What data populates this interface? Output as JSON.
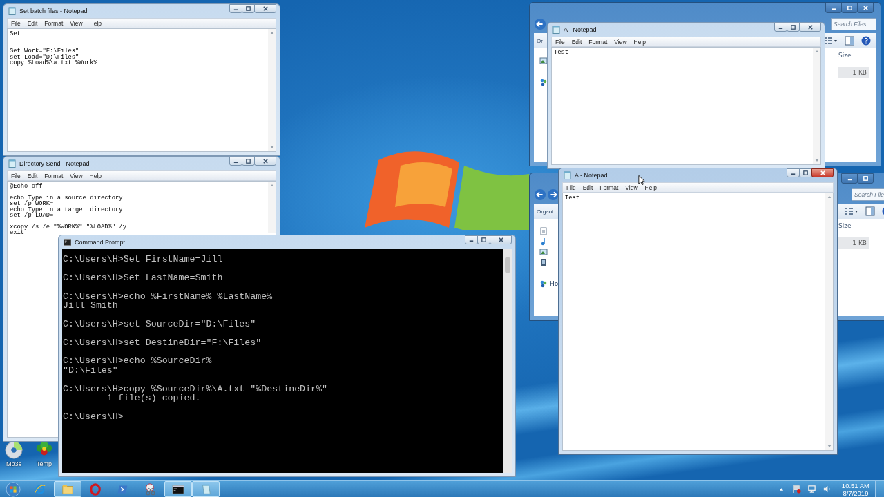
{
  "desktop_icons": [
    {
      "label": "Mp3s",
      "kind": "disc"
    },
    {
      "label": "Temp",
      "kind": "flower"
    }
  ],
  "explorer_windows": [
    {
      "search_placeholder": "Search Files",
      "toolbar_label": "Or",
      "column_header": "Size",
      "file_size": "1 KB",
      "nav_items": [
        {
          "kind": "pictures"
        },
        {
          "kind": "homegroup"
        }
      ]
    },
    {
      "search_placeholder": "Search File",
      "toolbar_label": "Organi",
      "column_header": "Size",
      "file_size": "1 KB",
      "nav_items": [
        {
          "kind": "document"
        },
        {
          "kind": "music"
        },
        {
          "kind": "pictures"
        },
        {
          "kind": "videos"
        },
        {
          "kind": "homegroup",
          "label": "Ho"
        }
      ]
    }
  ],
  "notepad_windows": [
    {
      "title": "A - Notepad",
      "active": false,
      "menu": [
        "File",
        "Edit",
        "Format",
        "View",
        "Help"
      ],
      "text": "Test"
    },
    {
      "title": "A - Notepad",
      "active": true,
      "menu": [
        "File",
        "Edit",
        "Format",
        "View",
        "Help"
      ],
      "text": "Test"
    },
    {
      "title": "Set batch files - Notepad",
      "active": false,
      "menu": [
        "File",
        "Edit",
        "Format",
        "View",
        "Help"
      ],
      "text": "Set\n\n\nSet Work=\"F:\\Files\"\nset Load=\"D:\\Files\"\ncopy %Load%\\a.txt %Work%"
    },
    {
      "title": "Directory Send - Notepad",
      "active": false,
      "menu": [
        "File",
        "Edit",
        "Format",
        "View",
        "Help"
      ],
      "text": "@Echo off\n\necho Type in a source directory\nset /p WORK=\necho Type in a target directory\nset /p LOAD=\n\nxcopy /s /e \"%WORK%\" \"%LOAD%\" /y\nexit"
    }
  ],
  "command_prompt": {
    "title": "Command Prompt",
    "active": false,
    "text": "C:\\Users\\H>Set FirstName=Jill\n\nC:\\Users\\H>Set LastName=Smith\n\nC:\\Users\\H>echo %FirstName% %LastName%\nJill Smith\n\nC:\\Users\\H>set SourceDir=\"D:\\Files\"\n\nC:\\Users\\H>set DestineDir=\"F:\\Files\"\n\nC:\\Users\\H>echo %SourceDir%\n\"D:\\Files\"\n\nC:\\Users\\H>copy %SourceDir%\\A.txt \"%DestineDir%\"\n        1 file(s) copied.\n\nC:\\Users\\H>"
  },
  "taskbar": {
    "apps": [
      {
        "kind": "ie",
        "open": false
      },
      {
        "kind": "explorer",
        "open": true
      },
      {
        "kind": "opera",
        "open": false
      },
      {
        "kind": "powershell",
        "open": false
      },
      {
        "kind": "snipping",
        "open": false
      },
      {
        "kind": "cmd",
        "open": true
      },
      {
        "kind": "notepad",
        "open": true
      }
    ],
    "clock": {
      "time": "10:51 AM",
      "date": "8/7/2019"
    }
  }
}
